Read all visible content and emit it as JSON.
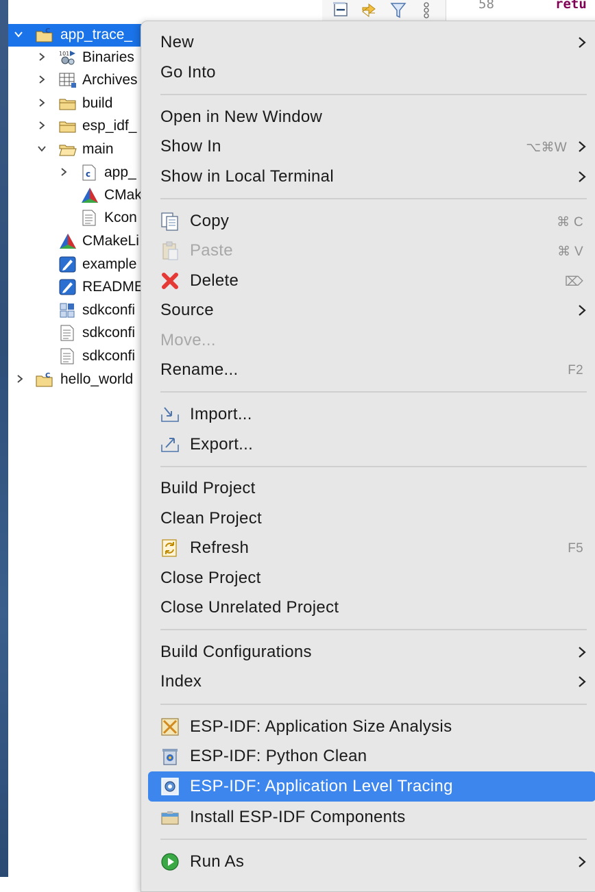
{
  "editor": {
    "line_number": "58",
    "code_fragment": "retu"
  },
  "tree": {
    "items": [
      {
        "label": "app_trace_",
        "icon": "c-project-icon"
      },
      {
        "label": "Binaries",
        "icon": "binaries-icon"
      },
      {
        "label": "Archives",
        "icon": "archives-icon"
      },
      {
        "label": "build",
        "icon": "folder-icon"
      },
      {
        "label": "esp_idf_",
        "icon": "folder-icon"
      },
      {
        "label": "main",
        "icon": "folder-open-icon"
      },
      {
        "label": "app_",
        "icon": "c-file-icon"
      },
      {
        "label": "CMak",
        "icon": "cmake-icon"
      },
      {
        "label": "Kcon",
        "icon": "text-file-icon"
      },
      {
        "label": "CMakeLi",
        "icon": "cmake-icon"
      },
      {
        "label": "example",
        "icon": "markdown-icon"
      },
      {
        "label": "README",
        "icon": "markdown-icon"
      },
      {
        "label": "sdkconfi",
        "icon": "sdkconfig-icon"
      },
      {
        "label": "sdkconfi",
        "icon": "text-file-icon"
      },
      {
        "label": "sdkconfi",
        "icon": "text-file-icon"
      },
      {
        "label": "hello_world",
        "icon": "c-project-icon"
      }
    ]
  },
  "menu": {
    "new": "New",
    "go_into": "Go Into",
    "open_new_window": "Open in New Window",
    "show_in": "Show In",
    "show_in_shortcut": "⌥⌘W",
    "show_local_terminal": "Show in Local Terminal",
    "copy": "Copy",
    "copy_shortcut": "⌘ C",
    "paste": "Paste",
    "paste_shortcut": "⌘ V",
    "delete": "Delete",
    "delete_shortcut": "⌦",
    "source": "Source",
    "move": "Move...",
    "rename": "Rename...",
    "rename_shortcut": "F2",
    "import": "Import...",
    "export": "Export...",
    "build_project": "Build Project",
    "clean_project": "Clean Project",
    "refresh": "Refresh",
    "refresh_shortcut": "F5",
    "close_project": "Close Project",
    "close_unrelated": "Close Unrelated Project",
    "build_configurations": "Build Configurations",
    "index": "Index",
    "size_analysis": "ESP-IDF: Application Size Analysis",
    "python_clean": "ESP-IDF: Python Clean",
    "app_level_tracing": "ESP-IDF: Application Level Tracing",
    "install_components": "Install ESP-IDF Components",
    "run_as": "Run As"
  },
  "colors": {
    "selection": "#1a73e8",
    "menu_highlight": "#3d86ee",
    "menu_bg": "#e7e7e7"
  }
}
